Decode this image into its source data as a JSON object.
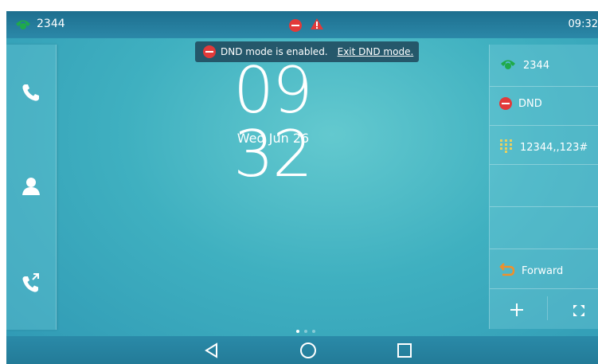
{
  "status_bar": {
    "line_number": "2344",
    "time": "09:32",
    "icons": [
      "phone-green-icon",
      "dnd-icon",
      "warning-icon"
    ]
  },
  "left_sidebar": {
    "buttons": [
      "phone-icon",
      "contacts-icon",
      "call-history-icon"
    ]
  },
  "toast": {
    "message": "DND mode is enabled.",
    "action": "Exit DND mode."
  },
  "clock": {
    "time": "09 32",
    "date": "Wed Jun 26"
  },
  "right_panel": {
    "account": "2344",
    "dnd_label": "DND",
    "speed_dial": "12344,,123#",
    "forward_label": "Forward",
    "add_icon": "plus-icon",
    "expand_icon": "expand-icon"
  },
  "page_indicator": {
    "pages": 3,
    "current": 1
  },
  "nav_bar": {
    "buttons": [
      "back-icon",
      "home-icon",
      "recents-icon"
    ]
  },
  "colors": {
    "accent_green": "#1faa4a",
    "dnd_red": "#e23a3a",
    "forward_orange": "#f0902a"
  }
}
